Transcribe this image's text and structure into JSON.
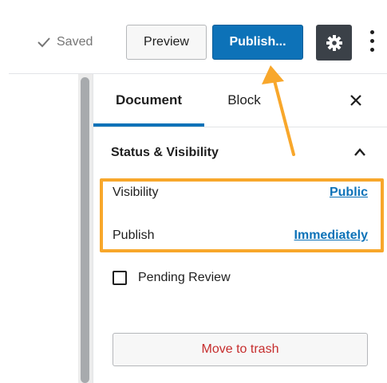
{
  "toolbar": {
    "saved_label": "Saved",
    "preview_label": "Preview",
    "publish_label": "Publish...",
    "settings_icon": "gear-icon",
    "more_icon": "more-vertical-icon"
  },
  "sidebar": {
    "tabs": [
      {
        "label": "Document",
        "active": true
      },
      {
        "label": "Block",
        "active": false
      }
    ],
    "panel": {
      "title": "Status & Visibility",
      "expanded": true,
      "rows": [
        {
          "label": "Visibility",
          "value": "Public"
        },
        {
          "label": "Publish",
          "value": "Immediately"
        }
      ],
      "pending_review_label": "Pending Review",
      "pending_review_checked": false,
      "trash_label": "Move to trash"
    }
  },
  "colors": {
    "accent": "#0d72b8",
    "highlight": "#f8a72b",
    "danger": "#c62d2d",
    "settings_bg": "#3b4148"
  }
}
